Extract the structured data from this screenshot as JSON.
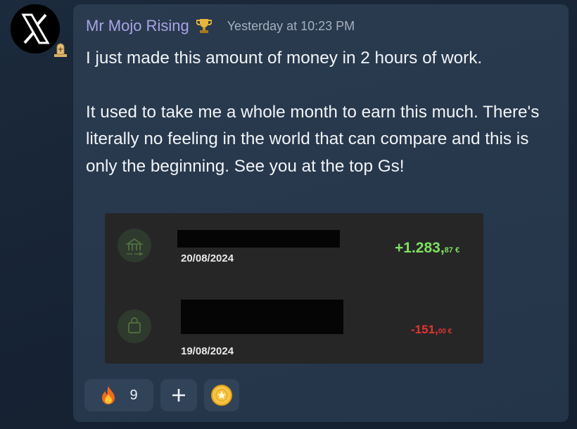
{
  "author": {
    "name": "Mr Mojo Rising",
    "avatar_icon": "x-logo-icon",
    "avatar_badge_icon": "gravestone-icon",
    "role_icon": "trophy-icon"
  },
  "timestamp": "Yesterday at 10:23 PM",
  "message": {
    "line1": "I just made this amount of money in 2 hours of work.",
    "line2": "It used to take me a whole month to earn this much. There's literally no feeling in the world that can compare and this is only the beginning. See you at the top Gs!"
  },
  "attachment": {
    "transactions": [
      {
        "icon": "bank-transfer-icon",
        "date": "20/08/2024",
        "amount_main": "+1.283,",
        "amount_cents": "87 €",
        "color": "#7ee05f"
      },
      {
        "icon": "shopping-bag-icon",
        "date": "19/08/2024",
        "amount_main": "-151,",
        "amount_cents": "00 €",
        "color": "#e3342f"
      }
    ]
  },
  "reactions": [
    {
      "emoji": "fire-icon",
      "count": "9"
    },
    {
      "emoji": "add-reaction-icon"
    },
    {
      "emoji": "coin-icon"
    }
  ],
  "colors": {
    "name": "#a9a3e6",
    "bubble": "#2a3b4f",
    "background": "#1b2a3c"
  }
}
